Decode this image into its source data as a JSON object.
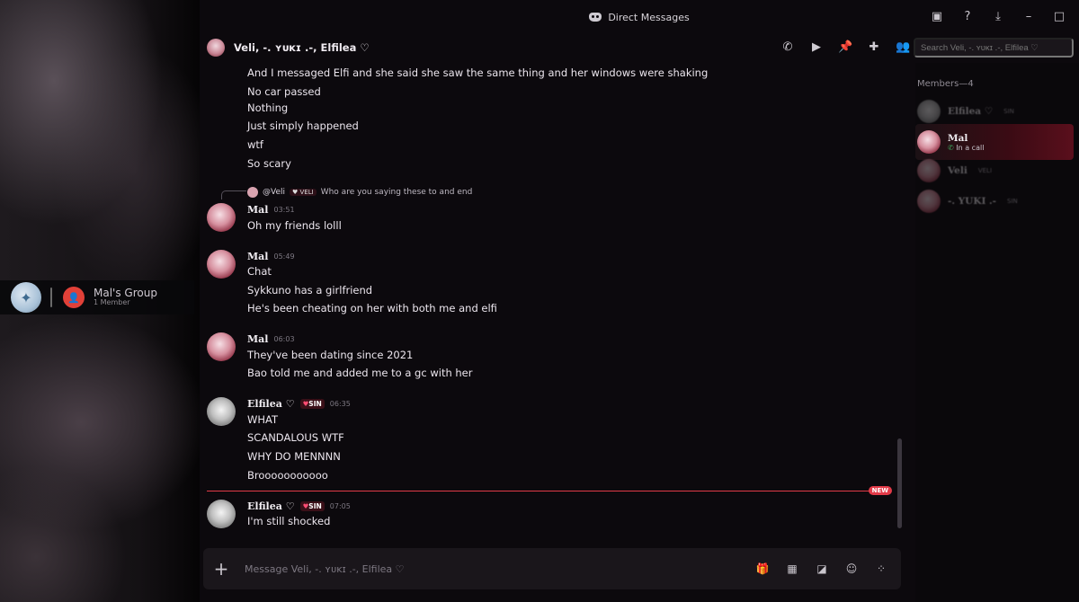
{
  "left_panel": {
    "group_name": "Mal's Group",
    "group_sub": "1 Member"
  },
  "titlebar": {
    "title": "Direct Messages"
  },
  "channel": {
    "name": "Veli, -. ʏᴜᴋɪ .-, Elfilea ♡"
  },
  "search": {
    "placeholder": "Search Veli, -. ʏᴜᴋɪ .-, Elfilea ♡"
  },
  "messages": {
    "block1": [
      "And I messaged Elfi and she said she saw the same thing and her windows were shaking",
      "No car passed",
      "Nothing",
      "Just simply happened",
      "wtf",
      "So scary"
    ],
    "reply": {
      "mention": "@Veli",
      "badge": "VELI",
      "text": "Who are you saying these to and end"
    },
    "mal1": {
      "author": "Mal",
      "time": "03:51",
      "lines": [
        "Oh my friends lolll"
      ]
    },
    "mal2": {
      "author": "Mal",
      "time": "05:49",
      "lines": [
        "Chat",
        "Sykkuno has a girlfriend",
        "He's been cheating on her with both me and elfi"
      ]
    },
    "mal3": {
      "author": "Mal",
      "time": "06:03",
      "lines": [
        "They've been dating since 2021",
        "Bao told me and added me to a gc with her"
      ]
    },
    "elf1": {
      "author": "Elfilea ♡",
      "badge": "SIN",
      "time": "06:35",
      "lines": [
        "WHAT",
        "SCANDALOUS WTF",
        "WHY DO MENNNN",
        "Brooooooooooo"
      ]
    },
    "new_label": "NEW",
    "elf2": {
      "author": "Elfilea ♡",
      "badge": "SIN",
      "time": "07:05",
      "lines": [
        "I'm still shocked"
      ]
    }
  },
  "composer": {
    "placeholder": "Message Veli, -. ʏᴜᴋɪ .-, Elfilea ♡"
  },
  "members": {
    "header": "Members—4",
    "list": [
      {
        "name": "Elfilea ♡",
        "tag": "SIN",
        "status": ""
      },
      {
        "name": "Mal",
        "tag": "",
        "status": "In a call"
      },
      {
        "name": "Veli",
        "tag": "VELI",
        "status": ""
      },
      {
        "name": "-. YUKI .-",
        "tag": "SIN",
        "status": ""
      }
    ]
  }
}
